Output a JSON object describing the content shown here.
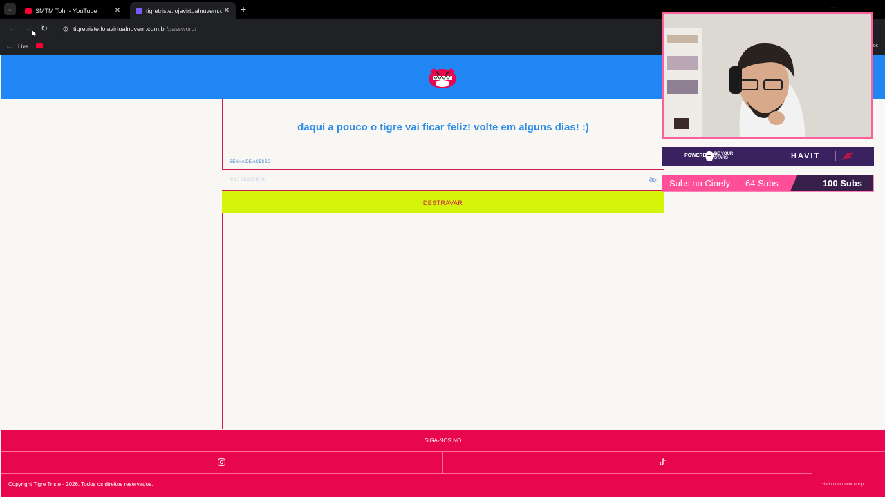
{
  "browser": {
    "tabs": [
      {
        "title": "SMTM Tohr - YouTube",
        "active": false
      },
      {
        "title": "tigretriste.lojavirtualnuvem.com",
        "active": true
      }
    ],
    "address": {
      "domain": "tigretriste.lojavirtualnuvem.com.br",
      "path": "/password/"
    },
    "bookmarks": [
      {
        "label": "Live"
      }
    ],
    "bookmarks_right": "os"
  },
  "page": {
    "message": "daqui a pouco o tigre vai ficar feliz! volte em alguns dias! :)",
    "password_label": "SENHA DE ACESSO",
    "password_placeholder": "ex.: suasenha",
    "unlock_button": "DESTRAVAR",
    "footer": {
      "follow_label": "SIGA-NOS NO",
      "copyright": "Copyright Tigre Triste - 2026. Todos os direitos reservados.",
      "credit": "criado com nuvemshop"
    }
  },
  "overlays": {
    "sponsor": {
      "powered_by": "POWERED BY",
      "brand_line1": "BE YOUR",
      "brand_line2": "STARS",
      "partner": "HAVIT"
    },
    "subs": {
      "label": "Subs no Cinefy",
      "current": "64 Subs",
      "goal": "100 Subs"
    }
  },
  "colors": {
    "header_blue": "#1f86f4",
    "accent_pink": "#e8074f",
    "button_lime": "#d4f50a",
    "text_blue": "#2d8ce6"
  }
}
